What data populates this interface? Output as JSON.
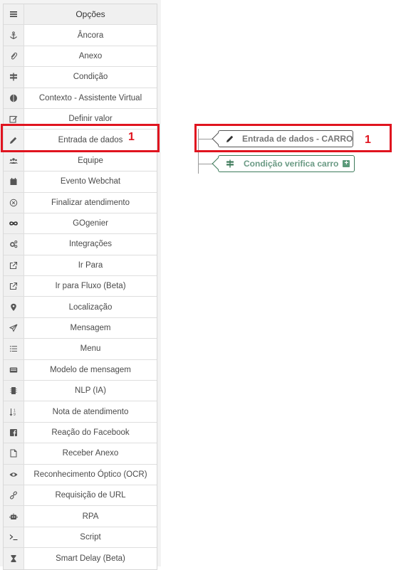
{
  "menu": {
    "header": "Opções",
    "items": [
      {
        "label": "Âncora",
        "icon": "anchor-icon"
      },
      {
        "label": "Anexo",
        "icon": "paperclip-icon"
      },
      {
        "label": "Condição",
        "icon": "signpost-icon"
      },
      {
        "label": "Contexto - Assistente Virtual",
        "icon": "brain-icon"
      },
      {
        "label": "Definir valor",
        "icon": "edit-square-icon"
      },
      {
        "label": "Entrada de dados",
        "icon": "pencil-icon"
      },
      {
        "label": "Equipe",
        "icon": "users-icon"
      },
      {
        "label": "Evento Webchat",
        "icon": "calendar-icon"
      },
      {
        "label": "Finalizar atendimento",
        "icon": "close-circle-icon"
      },
      {
        "label": "GOgenier",
        "icon": "infinity-icon"
      },
      {
        "label": "Integrações",
        "icon": "cogs-icon"
      },
      {
        "label": "Ir Para",
        "icon": "external-link-icon"
      },
      {
        "label": "Ir para Fluxo (Beta)",
        "icon": "external-link-icon"
      },
      {
        "label": "Localização",
        "icon": "map-pin-icon"
      },
      {
        "label": "Mensagem",
        "icon": "send-icon"
      },
      {
        "label": "Menu",
        "icon": "list-icon"
      },
      {
        "label": "Modelo de mensagem",
        "icon": "keyboard-icon"
      },
      {
        "label": "NLP (IA)",
        "icon": "chip-icon"
      },
      {
        "label": "Nota de atendimento",
        "icon": "sort-numeric-icon"
      },
      {
        "label": "Reação do Facebook",
        "icon": "facebook-icon"
      },
      {
        "label": "Receber Anexo",
        "icon": "file-icon"
      },
      {
        "label": "Reconhecimento Óptico (OCR)",
        "icon": "eye-icon"
      },
      {
        "label": "Requisição de URL",
        "icon": "link-icon"
      },
      {
        "label": "RPA",
        "icon": "robot-icon"
      },
      {
        "label": "Script",
        "icon": "terminal-icon"
      },
      {
        "label": "Smart Delay (Beta)",
        "icon": "hourglass-icon"
      }
    ]
  },
  "annotations": {
    "left_number": "1",
    "right_number": "1"
  },
  "flow": {
    "node_entrada": "Entrada de dados - CARRO",
    "node_condicao": "Condição verifica carro"
  },
  "colors": {
    "highlight": "#e0141f",
    "condition": "#3d7a5a"
  }
}
